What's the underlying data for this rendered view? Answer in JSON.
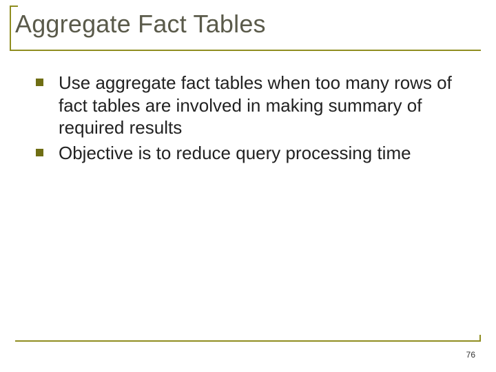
{
  "slide": {
    "title": "Aggregate Fact Tables",
    "bullets": [
      "Use aggregate fact tables when too many rows of fact tables are involved in making summary of required results",
      "Objective is to reduce query processing time"
    ],
    "page_number": "76"
  },
  "colors": {
    "accent": "#8f8d1f",
    "bullet": "#6f6e14",
    "title": "#5a5a4a"
  }
}
